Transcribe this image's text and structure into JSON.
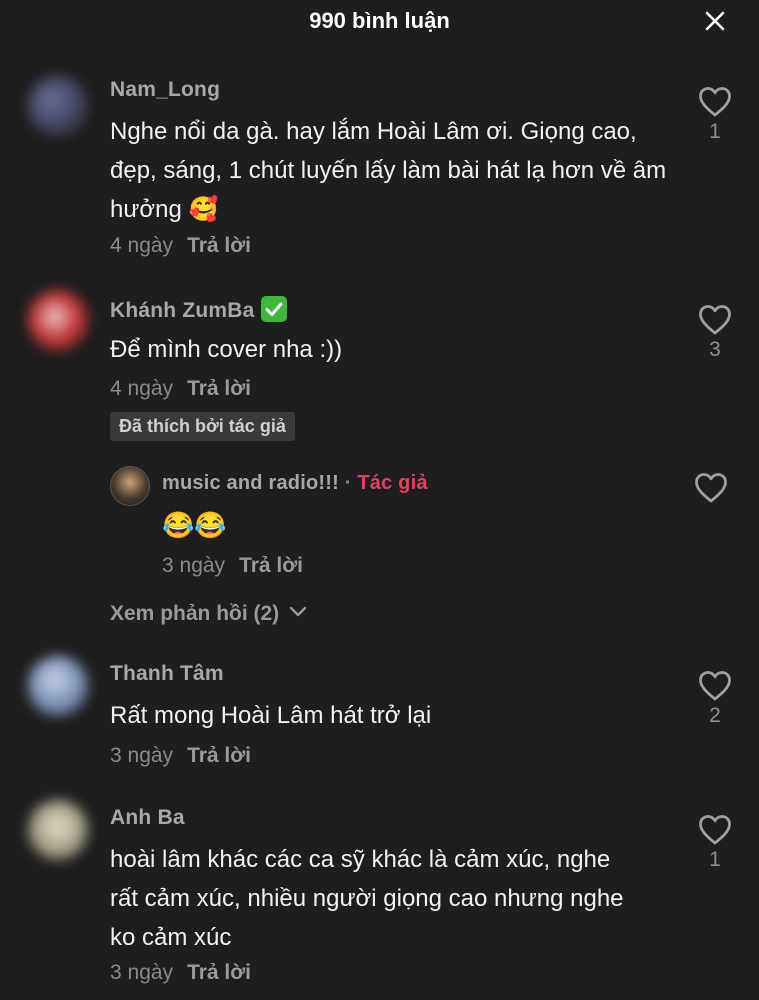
{
  "header": {
    "title": "990 bình luận"
  },
  "comments": [
    {
      "username": "Nam_Long",
      "text": "Nghe nổi da gà. hay lắm Hoài Lâm ơi. Giọng cao, đẹp, sáng, 1 chút luyến lấy làm bài hát lạ hơn về âm hưởng 🥰",
      "time": "4 ngày",
      "reply_label": "Trả lời",
      "likes": "1"
    },
    {
      "username": "Khánh ZumBa",
      "text": "Để mình cover nha :))",
      "time": "4 ngày",
      "reply_label": "Trả lời",
      "likes": "3",
      "liked_by_author": "Đã thích bởi tác giả"
    },
    {
      "username": "Thanh Tâm",
      "text": "Rất mong Hoài Lâm hát trở lại",
      "time": "3 ngày",
      "reply_label": "Trả lời",
      "likes": "2"
    },
    {
      "username": "Anh Ba",
      "text": "hoài lâm khác các ca sỹ khác là cảm xúc, nghe rất cảm xúc, nhiều người giọng cao nhưng nghe ko cảm xúc",
      "time": "3 ngày",
      "reply_label": "Trả lời",
      "likes": "1"
    }
  ],
  "reply": {
    "username": "music and radio!!!",
    "separator": "·",
    "author_tag": "Tác giả",
    "text": "😂😂",
    "time": "3 ngày",
    "reply_label": "Trả lời"
  },
  "view_replies": "Xem phản hồi (2)",
  "icons": {
    "close": "close-icon",
    "like": "heart-outline-icon",
    "verified": "check-badge-icon",
    "expand": "chevron-down-icon"
  },
  "colors": {
    "background": "#1e1e1e",
    "author_tag": "#e8405f",
    "verified": "#3fb73f"
  }
}
